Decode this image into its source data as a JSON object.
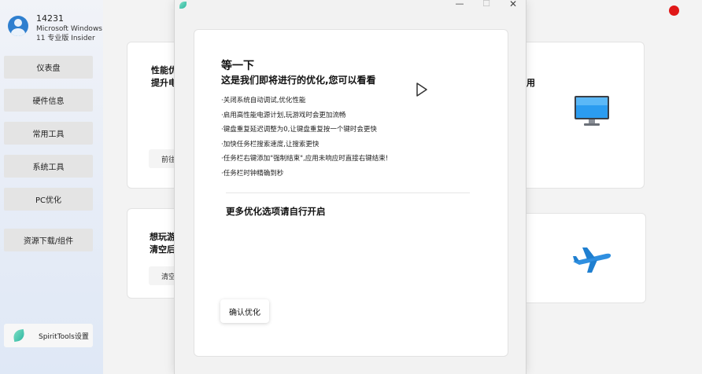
{
  "user": {
    "name": "14231",
    "os_line1": "Microsoft Windows",
    "os_line2": "11 专业版 Insider"
  },
  "sidebar": {
    "items": [
      {
        "label": "仪表盘"
      },
      {
        "label": "硬件信息"
      },
      {
        "label": "常用工具"
      },
      {
        "label": "系统工具"
      },
      {
        "label": "PC优化"
      },
      {
        "label": "资源下载/组件"
      }
    ],
    "settings_label": "SpiritTools设置"
  },
  "cards": {
    "card1": {
      "title": "性能优",
      "sub": "提升电",
      "button": "前往"
    },
    "card2": {
      "title": "想玩游",
      "sub": "清空后",
      "button": "清空"
    },
    "card3": {
      "text": "用"
    },
    "card3_icon": "monitor-icon",
    "card4_icon": "airplane-icon"
  },
  "dialog": {
    "title_main": "等一下",
    "title_sub": "这是我们即将进行的优化,您可以看看",
    "options": [
      "·关闭系统自动调试,优化性能",
      "·启用高性能电源计划,玩游戏时会更加流畅",
      "·键盘重复延迟调整为0,让键盘重复按一个键时会更快",
      "·加快任务栏搜索速度,让搜索更快",
      "·任务栏右键添加\"强制结束\",应用未响应时直接右键结束!",
      "·任务栏时钟精确到秒"
    ],
    "more_title": "更多优化选项请自行开启",
    "confirm_label": "确认优化",
    "controls": {
      "minimize": "—",
      "maximize": "☐",
      "close": "✕"
    }
  },
  "colors": {
    "accent": "#2f7fcf",
    "record_dot": "#e01818",
    "leaf": "#2bb5a0"
  }
}
